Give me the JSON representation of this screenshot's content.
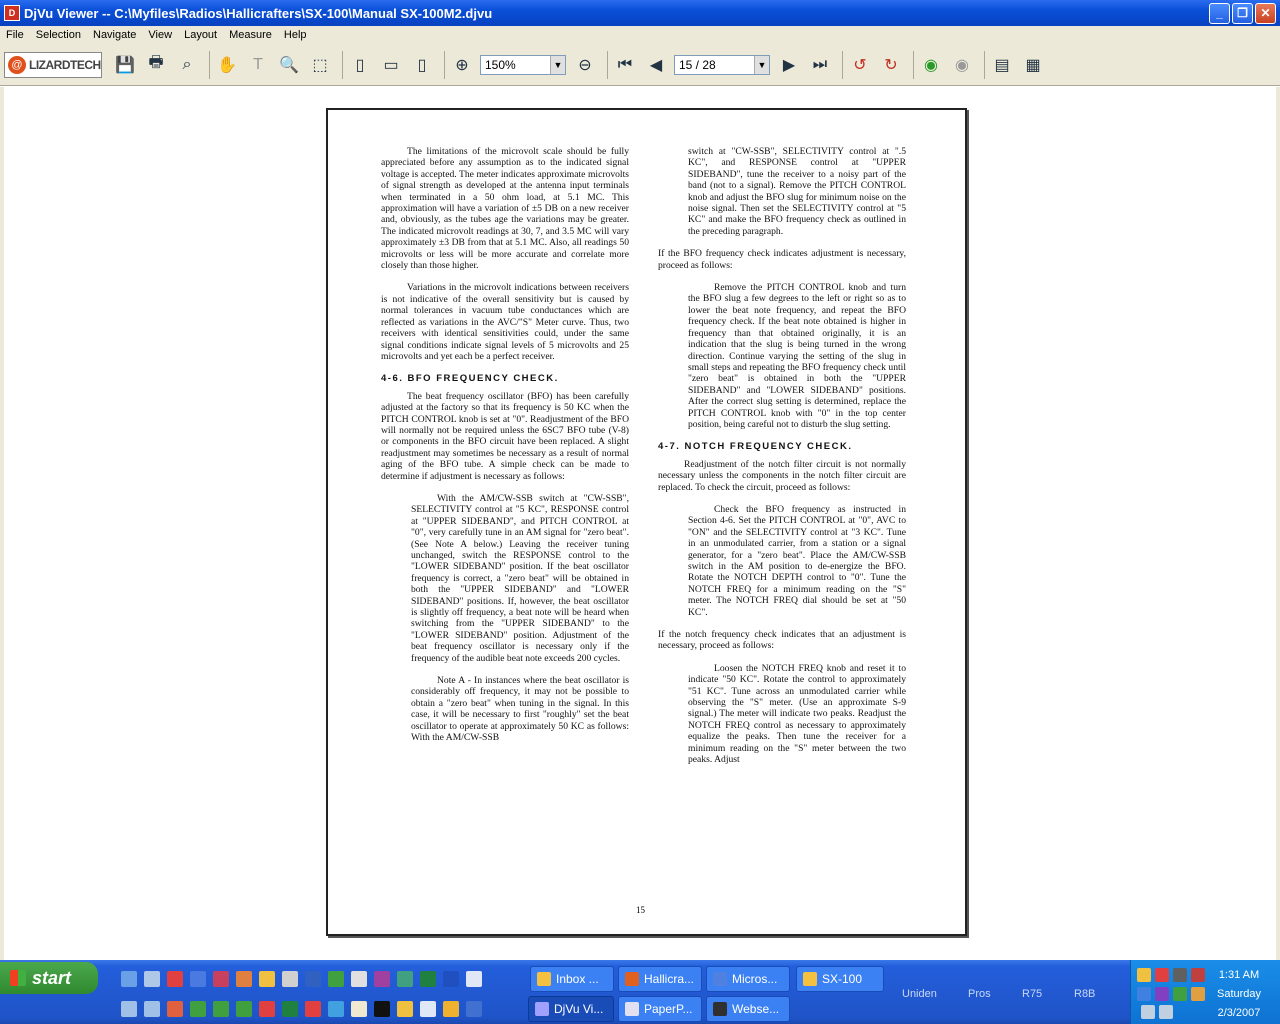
{
  "window": {
    "title": "DjVu Viewer -- C:\\Myfiles\\Radios\\Hallicrafters\\SX-100\\Manual SX-100M2.djvu"
  },
  "menu": [
    "File",
    "Selection",
    "Navigate",
    "View",
    "Layout",
    "Measure",
    "Help"
  ],
  "toolbar": {
    "logo": "LIZARDTECH",
    "zoom": "150%",
    "page": "15 / 28",
    "icons": [
      "save-icon",
      "print-icon",
      "find-icon",
      "hand-icon",
      "text-select-icon",
      "zoom-icon",
      "region-icon",
      "single-page-icon",
      "continuous-page-icon",
      "facing-page-icon",
      "zoom-in-icon",
      "zoom-out-icon",
      "first-page-icon",
      "prev-page-icon",
      "next-page-icon",
      "last-page-icon",
      "rotate-left-icon",
      "rotate-right-icon",
      "back-icon",
      "forward-icon",
      "thumbnails-icon",
      "grid-icon"
    ]
  },
  "document": {
    "left": {
      "p1": "The limitations of the microvolt scale should be fully appreciated before any assumption as to the indicated signal voltage is accepted. The meter indicates approximate microvolts of signal strength as developed at the antenna input terminals when terminated in a 50 ohm load, at 5.1 MC. This approximation will have a variation of ±5 DB on a new receiver and, obviously, as the tubes age the variations may be greater. The indicated microvolt readings at 30, 7, and 3.5 MC will vary approximately ±3 DB from that at 5.1 MC. Also, all readings 50 microvolts or less will be more accurate and correlate more closely than those higher.",
      "p2": "Variations in the microvolt indications between receivers is not indicative of the overall sensitivity but is caused by normal tolerances in vacuum tube conductances which are reflected as variations in the AVC/\"S\" Meter curve. Thus, two receivers with identical sensitivities could, under the same signal conditions indicate signal levels of 5 microvolts and 25 microvolts and yet each be a perfect receiver.",
      "h1": "4-6. BFO FREQUENCY CHECK.",
      "p3": "The beat frequency oscillator (BFO) has been carefully adjusted at the factory so that its frequency is 50 KC when the PITCH CONTROL knob is set at \"0\". Readjustment of the BFO will normally not be required unless the 6SC7 BFO tube (V-8) or components in the BFO circuit have been replaced. A slight readjustment may sometimes be necessary as a result of normal aging of the BFO tube. A simple check can be made to determine if adjustment is necessary as follows:",
      "p4": "With the AM/CW-SSB switch at \"CW-SSB\", SELECTIVITY control at \"5 KC\", RESPONSE control at \"UPPER SIDEBAND\", and PITCH CONTROL at \"0\", very carefully tune in an AM signal for \"zero beat\". (See Note A below.) Leaving the receiver tuning unchanged, switch the RESPONSE control to the \"LOWER SIDEBAND\" position. If the beat oscillator frequency is correct, a \"zero beat\" will be obtained in both the \"UPPER SIDEBAND\" and \"LOWER SIDEBAND\" positions. If, however, the beat oscillator is slightly off frequency, a beat note will be heard when switching from the \"UPPER SIDEBAND\" to the \"LOWER SIDEBAND\" position. Adjustment of the beat frequency oscillator is necessary only if the frequency of the audible beat note exceeds 200 cycles.",
      "p5": "Note A - In instances where the beat oscillator is considerably off frequency, it may not be possible to obtain a \"zero beat\" when tuning in the signal. In this case, it will be necessary to first \"roughly\" set the beat oscillator to operate at approximately 50 KC as follows: With the AM/CW-SSB"
    },
    "right": {
      "p1": "switch at \"CW-SSB\", SELECTIVITY control at \".5 KC\", and RESPONSE control at \"UPPER SIDEBAND\", tune the receiver to a noisy part of the band (not to a signal). Remove the PITCH CONTROL knob and adjust the BFO slug for minimum noise on the noise signal. Then set the SELECTIVITY control at \"5 KC\" and make the BFO frequency check as outlined in the preceding paragraph.",
      "p2": "If the BFO frequency check indicates adjustment is necessary, proceed as follows:",
      "p3": "Remove the PITCH CONTROL knob and turn the BFO slug a few degrees to the left or right so as to lower the beat note frequency, and repeat the BFO frequency check. If the beat note obtained is higher in frequency than that obtained originally, it is an indication that the slug is being turned in the wrong direction. Continue varying the setting of the slug in small steps and repeating the BFO frequency check until \"zero beat\" is obtained in both the \"UPPER SIDEBAND\" and \"LOWER SIDEBAND\" positions. After the correct slug setting is determined, replace the PITCH CONTROL knob with \"0\" in the top center position, being careful not to disturb the slug setting.",
      "h1": "4-7. NOTCH FREQUENCY CHECK.",
      "p4": "Readjustment of the notch filter circuit is not normally necessary unless the components in the notch filter circuit are replaced. To check the circuit, proceed as follows:",
      "p5": "Check the BFO frequency as instructed in Section 4-6. Set the PITCH CONTROL at \"0\", AVC to \"ON\" and the SELECTIVITY control at \"3 KC\". Tune in an unmodulated carrier, from a station or a signal generator, for a \"zero beat\". Place the AM/CW-SSB switch in the AM position to de-energize the BFO. Rotate the NOTCH DEPTH control to \"0\". Tune the NOTCH FREQ for a minimum reading on the \"S\" meter. The NOTCH FREQ dial should be set at \"50 KC\".",
      "p6": "If the notch frequency check indicates that an adjustment is necessary, proceed as follows:",
      "p7": "Loosen the NOTCH FREQ knob and reset it to indicate \"50 KC\". Rotate the control to approximately \"51 KC\". Tune across an unmodulated carrier while observing the \"S\" meter. (Use an approximate S-9 signal.) The meter will indicate two peaks. Readjust the NOTCH FREQ control as necessary to approximately equalize the peaks. Then tune the receiver for a minimum reading on the \"S\" meter between the two peaks. Adjust"
    },
    "page_number": "15"
  },
  "taskbar": {
    "start": "start",
    "row1": [
      "Inbox ...",
      "Hallicra...",
      "Micros...",
      "SX-100"
    ],
    "row2": [
      "DjVu Vi...",
      "PaperP...",
      "Webse..."
    ],
    "groups": [
      "Uniden",
      "Pros",
      "R75",
      "R8B"
    ],
    "clock": {
      "time": "1:31 AM",
      "day": "Saturday",
      "date": "2/3/2007"
    }
  }
}
